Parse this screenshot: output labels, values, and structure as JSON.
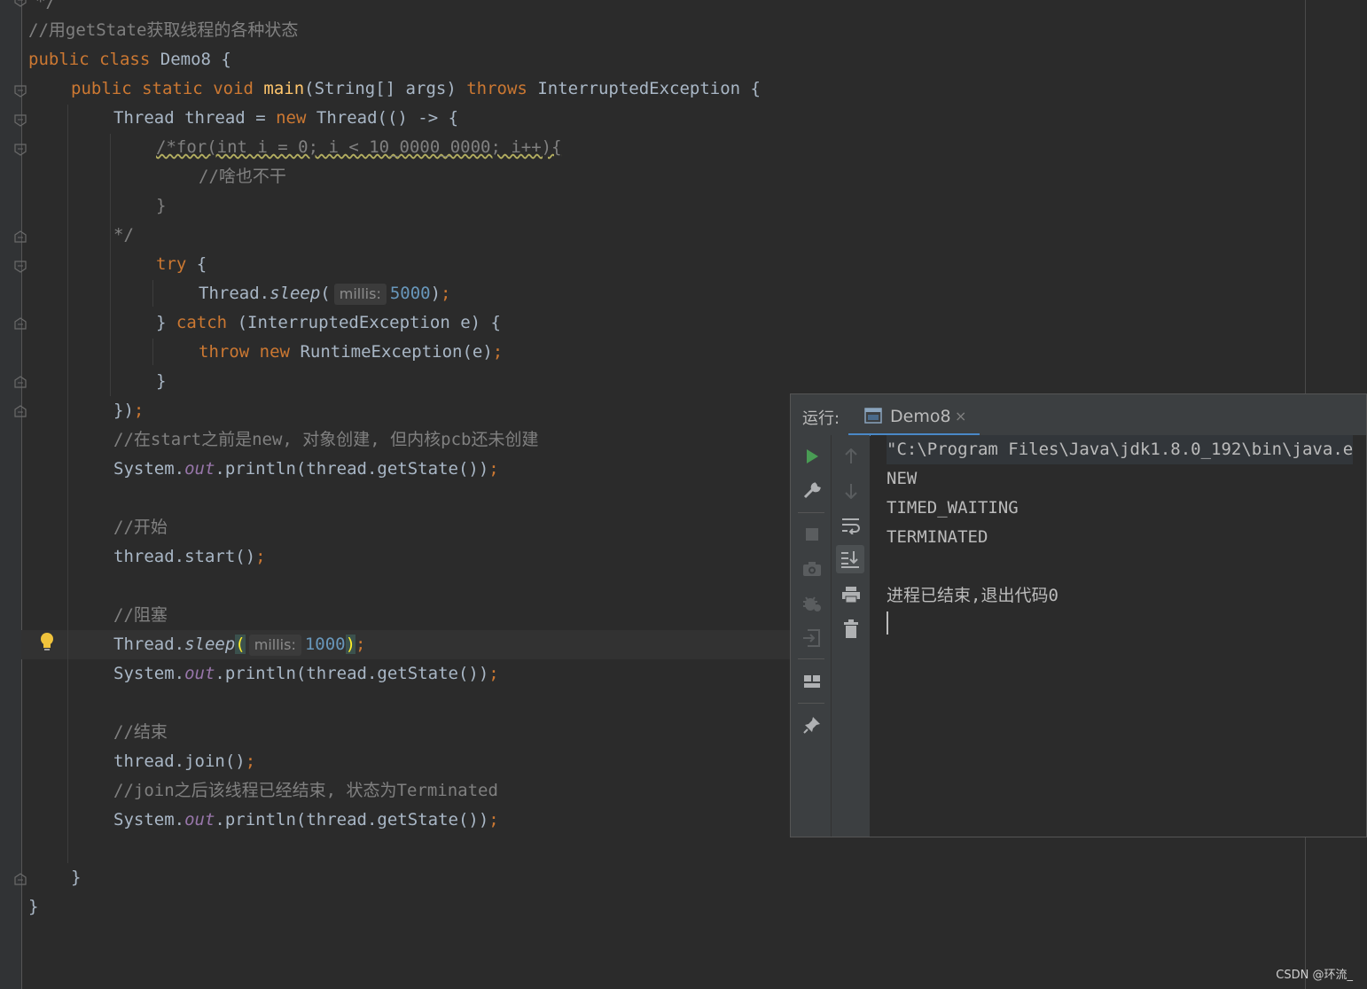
{
  "editor": {
    "lines": [
      {
        "comment": "*/"
      },
      {
        "comment": "//用getState获取线程的各种状态"
      },
      {
        "kw1": "public",
        "kw2": "class",
        "name": "Demo8",
        "brace": "{"
      },
      {
        "kw1": "public",
        "kw2": "static",
        "kw3": "void",
        "method": "main",
        "params": "(String[] args)",
        "throws": "throws",
        "exc": "InterruptedException",
        "brace": "{"
      },
      {
        "type": "Thread",
        "var": "thread",
        "eq": "=",
        "new": "new",
        "ctor": "Thread(() -> {"
      },
      {
        "comment": "/*for(int i = 0; i < 10_0000_0000; i++){"
      },
      {
        "comment": "//啥也不干"
      },
      {
        "comment": "}"
      },
      {
        "comment": "*/"
      },
      {
        "kw": "try",
        "brace": "{"
      },
      {
        "cls": "Thread.",
        "method": "sleep",
        "open": "(",
        "hint": "millis:",
        "num": "5000",
        "close": ")",
        "semi": ";"
      },
      {
        "brace": "}",
        "kw": "catch",
        "rest": "(InterruptedException e) {"
      },
      {
        "kw1": "throw",
        "kw2": "new",
        "rest": "RuntimeException(e)",
        "semi": ";"
      },
      {
        "brace": "}"
      },
      {
        "text": "})",
        "semi": ";"
      },
      {
        "comment": "//在start之前是new, 对象创建, 但内核pcb还未创建"
      },
      {
        "a": "System.",
        "out": "out",
        "b": ".println(thread.getState())",
        "semi": ";"
      },
      {
        "comment": "//开始"
      },
      {
        "text": "thread.start()",
        "semi": ";"
      },
      {
        "comment": "//阻塞"
      },
      {
        "cls": "Thread.",
        "method": "sleep",
        "open": "(",
        "hint": "millis:",
        "num": "1000",
        "close": ")",
        "semi": ";"
      },
      {
        "a": "System.",
        "out": "out",
        "b": ".println(thread.getState())",
        "semi": ";"
      },
      {
        "comment": "//结束"
      },
      {
        "text": "thread.join()",
        "semi": ";"
      },
      {
        "comment": "//join之后该线程已经结束, 状态为Terminated"
      },
      {
        "a": "System.",
        "out": "out",
        "b": ".println(thread.getState())",
        "semi": ";"
      },
      {
        "brace": "}"
      },
      {
        "brace": "}"
      }
    ]
  },
  "run_panel": {
    "title": "运行:",
    "tab_label": "Demo8",
    "tab_close": "×",
    "console": [
      "\"C:\\Program Files\\Java\\jdk1.8.0_192\\bin\\java.e",
      "NEW",
      "TIMED_WAITING",
      "TERMINATED",
      "",
      "进程已结束,退出代码0"
    ],
    "toolbar_left": [
      "run-icon",
      "wrench-icon",
      "stop-icon",
      "camera-icon",
      "debug-icon",
      "exit-icon",
      "layout-icon",
      "pin-icon"
    ],
    "toolbar_right": [
      "up-arrow-icon",
      "down-arrow-icon",
      "soft-wrap-icon",
      "scroll-to-end-icon",
      "print-icon",
      "trash-icon"
    ]
  },
  "watermark": "CSDN @环流_",
  "colors": {
    "background": "#2b2b2b",
    "keyword": "#cc7832",
    "method": "#ffc66d",
    "comment": "#808080",
    "number": "#6897bb",
    "static_field": "#9876aa",
    "text": "#a9b7c6"
  }
}
